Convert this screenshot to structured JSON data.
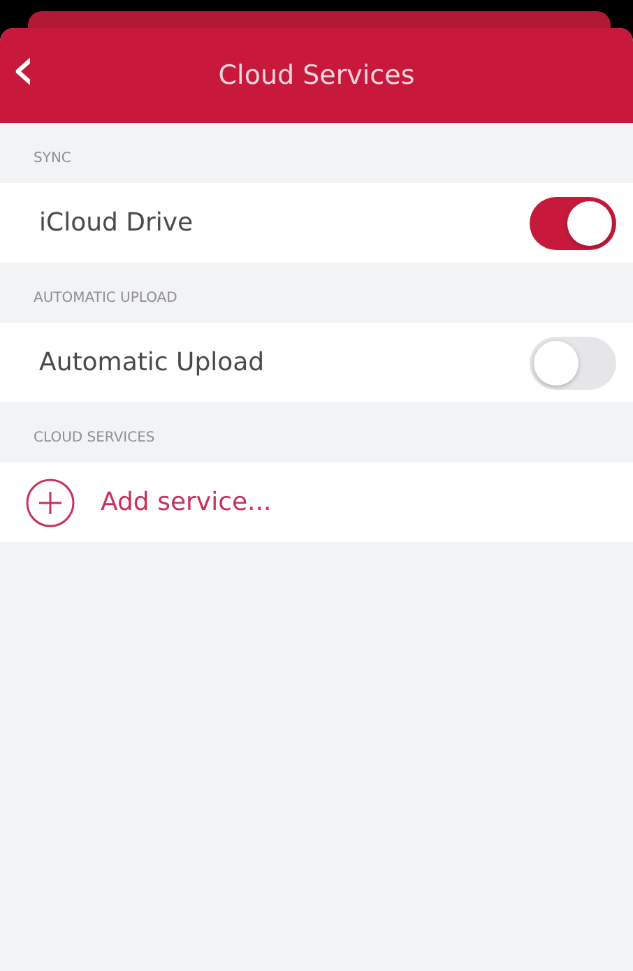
{
  "header": {
    "back": "‹",
    "title": "Cloud Services"
  },
  "sections": [
    {
      "title": "SYNC",
      "rows": [
        {
          "kind": "toggle",
          "label": "iCloud Drive",
          "on": true
        }
      ]
    },
    {
      "title": "AUTOMATIC UPLOAD",
      "rows": [
        {
          "kind": "toggle",
          "label": "Automatic Upload",
          "on": false
        }
      ]
    },
    {
      "title": "CLOUD SERVICES",
      "rows": [
        {
          "kind": "action",
          "label": "Add service..."
        }
      ]
    }
  ]
}
